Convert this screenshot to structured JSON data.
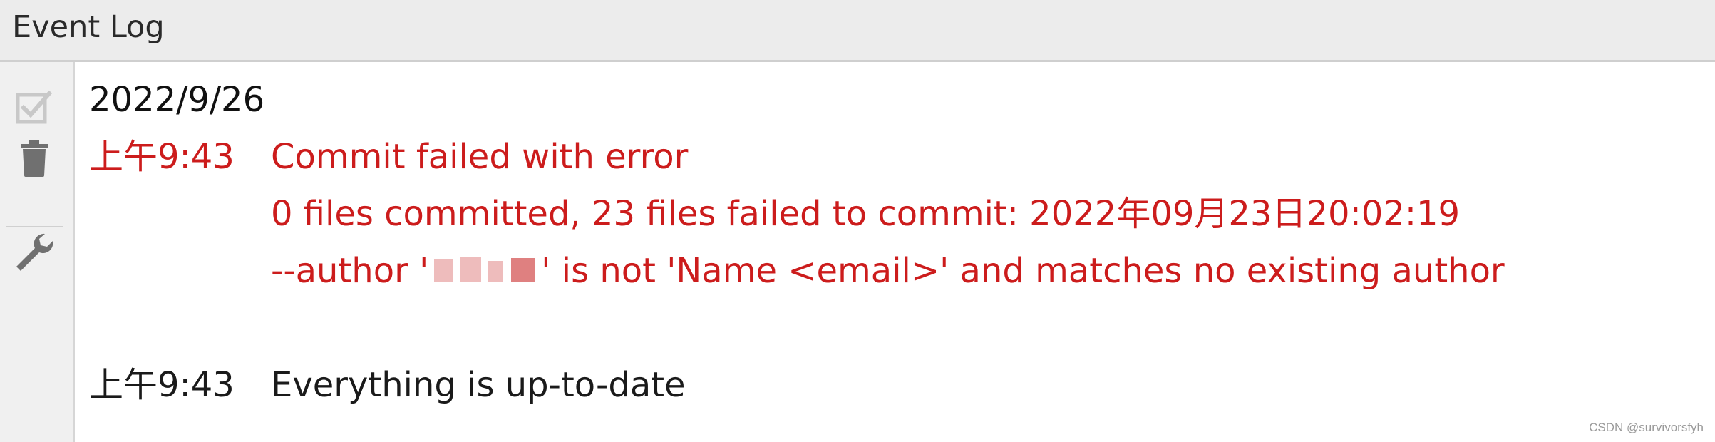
{
  "window": {
    "title": "Event Log"
  },
  "toolbar": {
    "icons": [
      "checkbox-check-icon",
      "trash-icon",
      "wrench-icon"
    ]
  },
  "log": {
    "date": "2022/9/26",
    "entries": [
      {
        "time": "上午9:43",
        "title": "Commit failed with error",
        "line2": "0 files committed, 23 files failed to commit: 2022年09月23日20:02:19",
        "line3_prefix": "--author '",
        "line3_suffix": "' is not 'Name <email>' and matches no existing author"
      },
      {
        "time": "上午9:43",
        "title": "Everything is up-to-date"
      }
    ]
  },
  "colors": {
    "error": "#cc1c1c",
    "text": "#1a1a1a",
    "panel": "#ececec"
  },
  "watermark": "CSDN @survivorsfyh"
}
